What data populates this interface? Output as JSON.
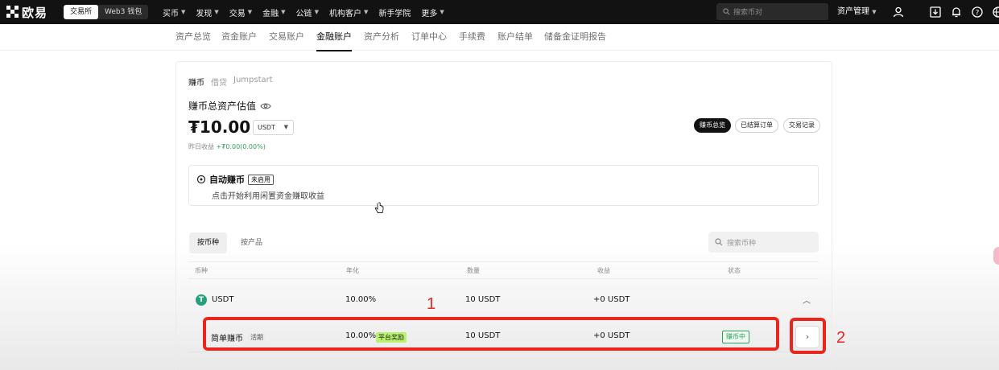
{
  "topbar": {
    "logo_text": "欧易",
    "seg": [
      "交易所",
      "Web3 钱包"
    ],
    "menu": [
      {
        "label": "买币",
        "caret": true
      },
      {
        "label": "发现",
        "caret": true
      },
      {
        "label": "交易",
        "caret": true
      },
      {
        "label": "金融",
        "caret": true
      },
      {
        "label": "公链",
        "caret": true
      },
      {
        "label": "机构客户",
        "caret": true
      },
      {
        "label": "新手学院",
        "caret": false
      },
      {
        "label": "更多",
        "caret": true
      }
    ],
    "search_placeholder": "搜索币对",
    "asset_mgmt": "资产管理",
    "icons": [
      "user-icon",
      "download-icon",
      "bell-icon",
      "help-icon",
      "globe-icon"
    ]
  },
  "subnav": [
    "资产总览",
    "资金账户",
    "交易账户",
    "金融账户",
    "资产分析",
    "订单中心",
    "手续费",
    "账户结单",
    "储备金证明报告"
  ],
  "subnav_active": "金融账户",
  "product_tabs": [
    "赚币",
    "借贷",
    "Jumpstart"
  ],
  "summary": {
    "title": "赚币总资产估值",
    "amount": "₮10.00",
    "currency": "USDT",
    "yesterday_label": "昨日收益",
    "yesterday_value": "+₮0.00(0.00%)"
  },
  "view_buttons": [
    "赚币总览",
    "已结算订单",
    "交易记录"
  ],
  "auto_earn": {
    "title": "自动赚币",
    "badge": "未启用",
    "desc": "点击开始利用闲置资金赚取收益"
  },
  "filter_tabs": [
    "按币种",
    "按产品"
  ],
  "coin_search_placeholder": "搜索币种",
  "table": {
    "headers": [
      "币种",
      "年化",
      "数量",
      "收益",
      "状态"
    ],
    "coin_row": {
      "coin": "USDT",
      "apr": "10.00%",
      "qty": "10 USDT",
      "income": "+0 USDT"
    },
    "product_row": {
      "name": "简单赚币",
      "type": "活期",
      "apr": "10.00%",
      "bonus": "平台奖励",
      "qty": "10 USDT",
      "income": "+0 USDT",
      "status": "赚币中"
    }
  },
  "annotations": [
    "1",
    "2"
  ],
  "colors": {
    "highlight": "#e8261d",
    "accent_green": "#2f9d5b",
    "tag_lime": "#b9f36e"
  }
}
